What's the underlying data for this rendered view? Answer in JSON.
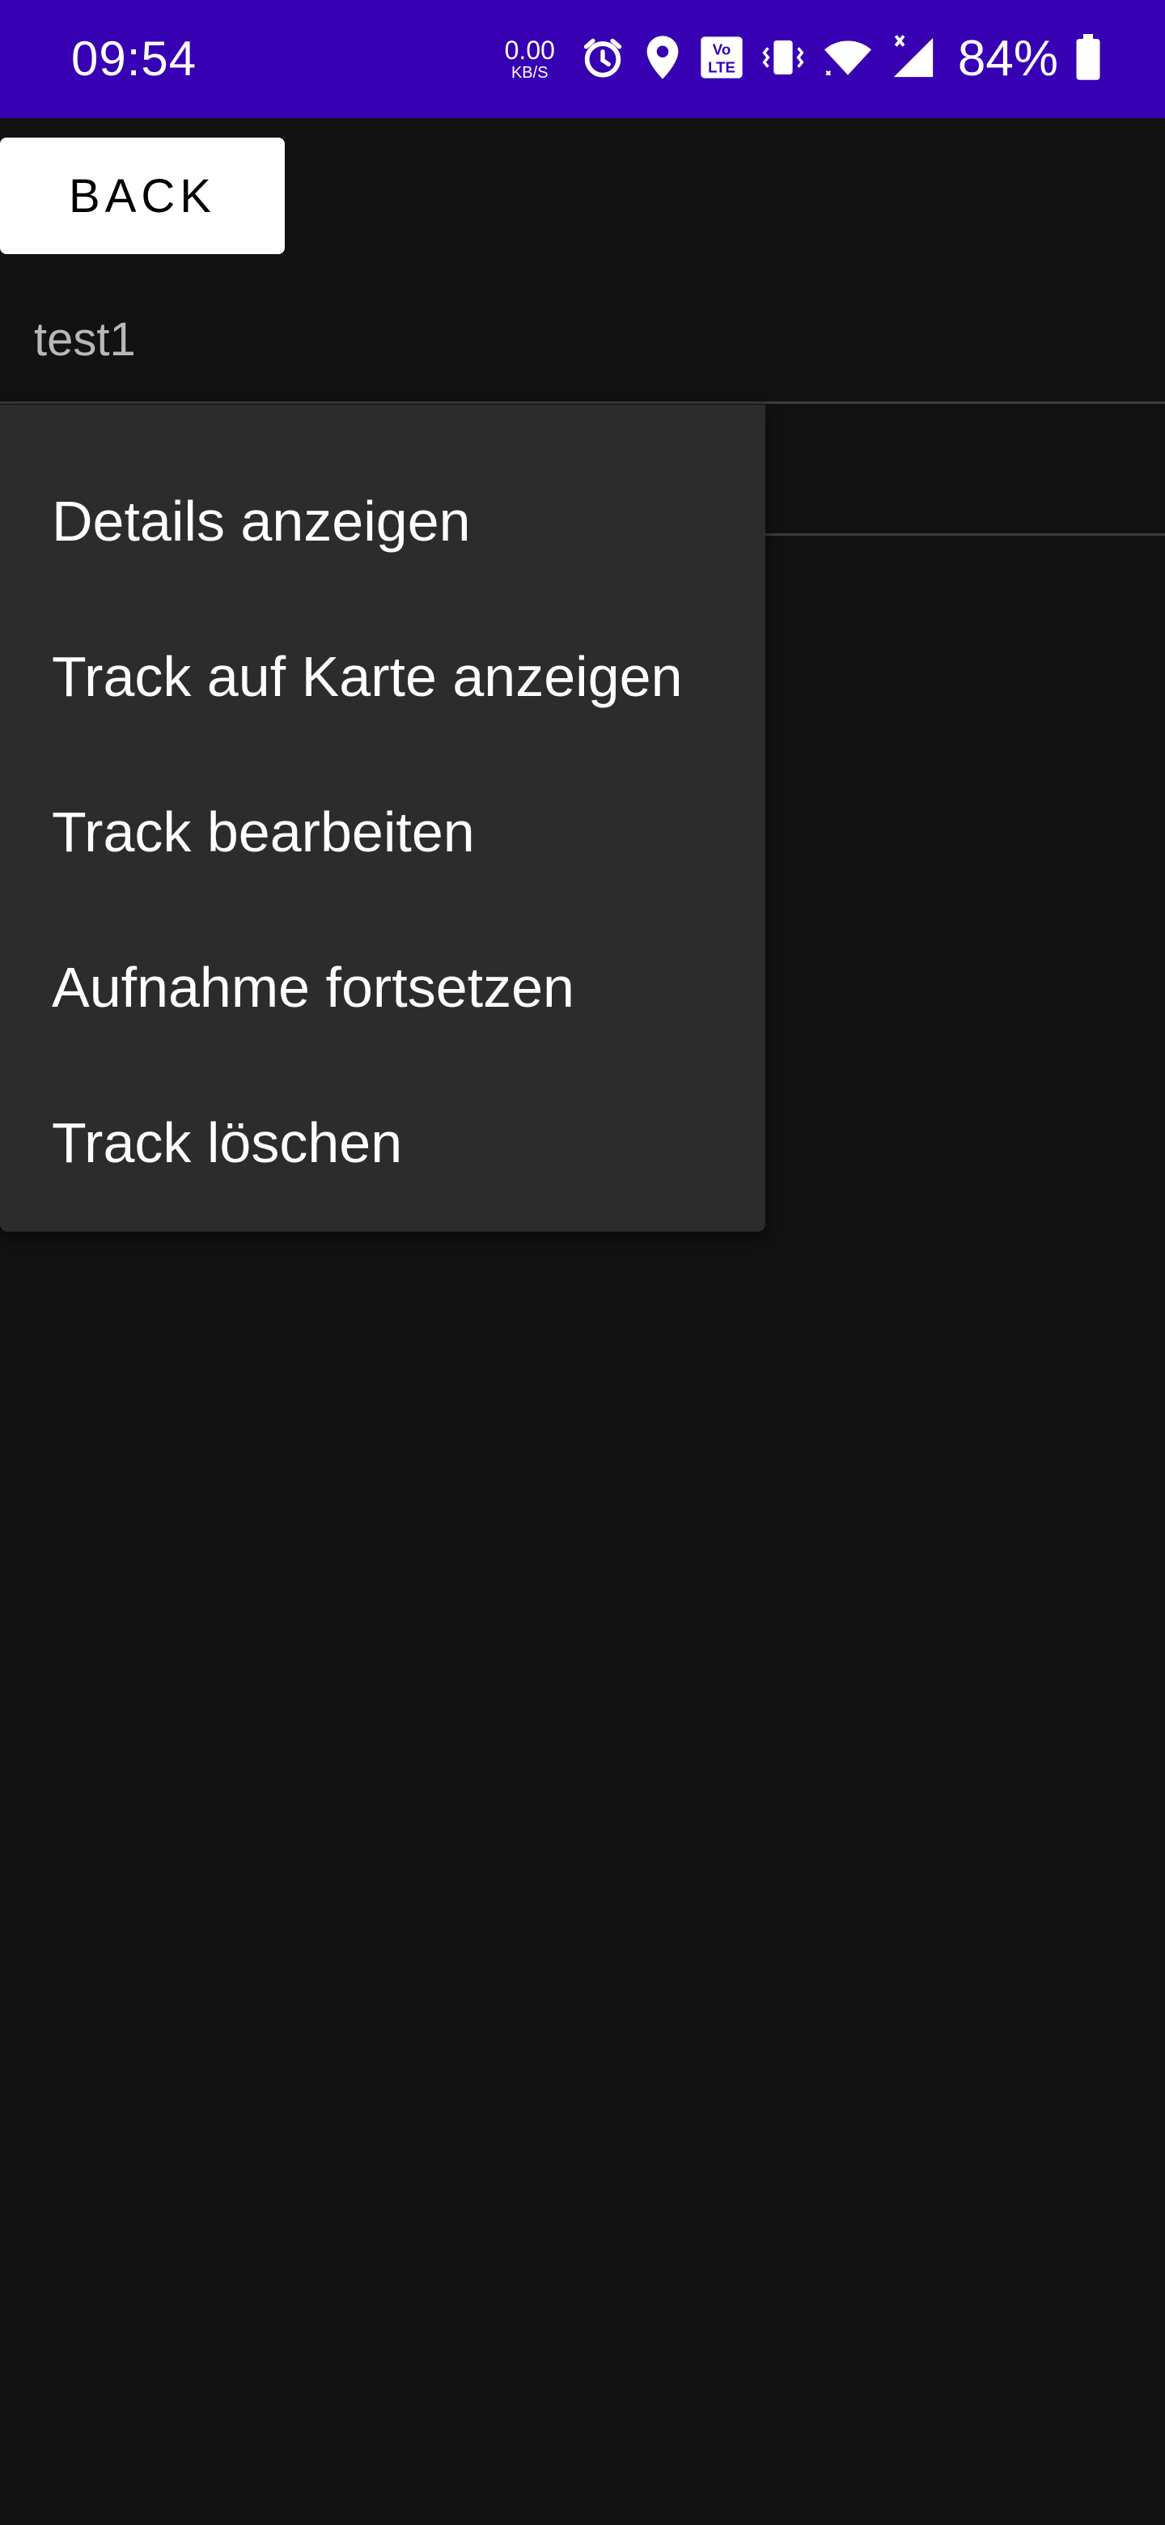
{
  "status_bar": {
    "time": "09:54",
    "net_speed_value": "0.00",
    "net_speed_unit": "KB/S",
    "battery_percent": "84%",
    "icons": [
      "alarm-icon",
      "location-icon",
      "volte-icon",
      "vibrate-icon",
      "wifi-icon",
      "signal-icon",
      "battery-icon"
    ],
    "background_color": "#3700b3"
  },
  "toolbar": {
    "back_label": "BACK"
  },
  "track_list": {
    "items": [
      {
        "name": "test1"
      },
      {
        "name": ""
      }
    ]
  },
  "context_menu": {
    "items": [
      {
        "label": "Details anzeigen"
      },
      {
        "label": "Track auf Karte anzeigen"
      },
      {
        "label": "Track bearbeiten"
      },
      {
        "label": "Aufnahme fortsetzen"
      },
      {
        "label": "Track löschen"
      }
    ]
  }
}
